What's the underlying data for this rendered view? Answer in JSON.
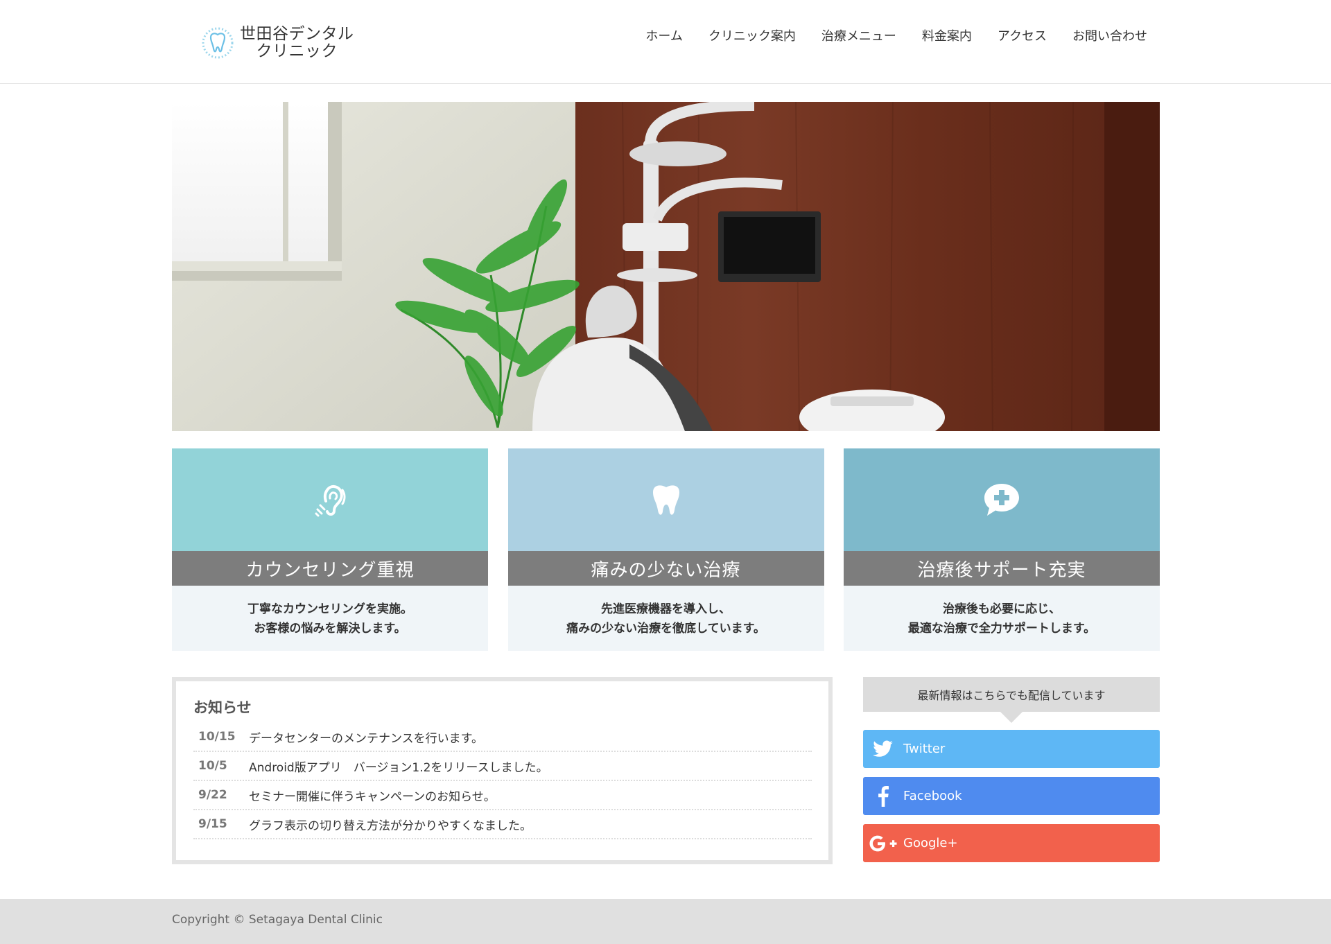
{
  "header": {
    "logo_line1": "世田谷デンタル",
    "logo_line2": "クリニック",
    "nav": [
      "ホーム",
      "クリニック案内",
      "治療メニュー",
      "料金案内",
      "アクセス",
      "お問い合わせ"
    ]
  },
  "features": [
    {
      "icon": "ear-listening-icon",
      "color": "#92d3d8",
      "title": "カウンセリング重視",
      "desc1": "丁寧なカウンセリングを実施。",
      "desc2": "お客様の悩みを解決します。"
    },
    {
      "icon": "tooth-icon",
      "color": "#acd0e2",
      "title": "痛みの少ない治療",
      "desc1": "先進医療機器を導入し、",
      "desc2": "痛みの少ない治療を徹底しています。"
    },
    {
      "icon": "chat-plus-icon",
      "color": "#7eb9cb",
      "title": "治療後サポート充実",
      "desc1": "治療後も必要に応じ、",
      "desc2": "最適な治療で全力サポートします。"
    }
  ],
  "news": {
    "title": "お知らせ",
    "items": [
      {
        "date": "10/15",
        "text": "データセンターのメンテナンスを行います。"
      },
      {
        "date": "10/5",
        "text": "Android版アプリ　バージョン1.2をリリースしました。"
      },
      {
        "date": "9/22",
        "text": "セミナー開催に伴うキャンペーンのお知らせ。"
      },
      {
        "date": "9/15",
        "text": "グラフ表示の切り替え方法が分かりやすくなました。"
      }
    ]
  },
  "social": {
    "heading": "最新情報はこちらでも配信しています",
    "twitter": "Twitter",
    "facebook": "Facebook",
    "google": "Google+",
    "colors": {
      "twitter": "#5eb7f5",
      "facebook": "#4f8bef",
      "google": "#f2614c"
    }
  },
  "footer": {
    "copyright": "Copyright © Setagaya Dental Clinic"
  }
}
